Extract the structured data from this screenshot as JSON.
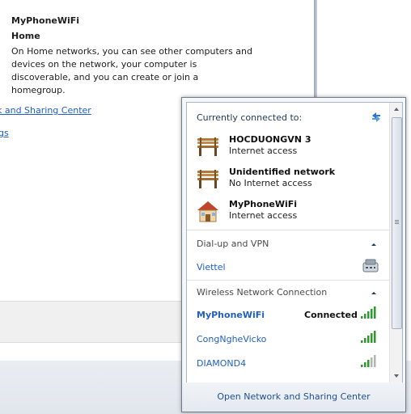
{
  "background_window": {
    "title": "MyPhoneWiFi",
    "subtitle": "Home",
    "description": "On Home networks, you can see other computers and devices on the network, your computer is discoverable, and you can create or join a homegroup.",
    "link_sharing_center": "k and Sharing Center",
    "link_settings": "gs"
  },
  "flyout": {
    "header": "Currently connected to:",
    "connections": [
      {
        "name": "HOCDUONGVN  3",
        "status": "Internet access",
        "icon": "bench-network-icon"
      },
      {
        "name": "Unidentified network",
        "status": "No Internet access",
        "icon": "bench-network-icon"
      },
      {
        "name": "MyPhoneWiFi",
        "status": "Internet access",
        "icon": "house-network-icon"
      }
    ],
    "dialup_section": {
      "title": "Dial-up and VPN",
      "items": [
        {
          "label": "Viettel",
          "icon": "modem-icon"
        }
      ]
    },
    "wireless_section": {
      "title": "Wireless Network Connection",
      "networks": [
        {
          "name": "MyPhoneWiFi",
          "status": "Connected",
          "signal_bars": 5
        },
        {
          "name": "CongNgheVicko",
          "status": "",
          "signal_bars": 5
        },
        {
          "name": "DIAMOND4",
          "status": "",
          "signal_bars": 3
        }
      ]
    },
    "footer_link": "Open Network and Sharing Center"
  },
  "colors": {
    "link": "#1f5fc6",
    "signal_green": "#2f9a2f",
    "signal_gray": "#b4b4b4"
  }
}
